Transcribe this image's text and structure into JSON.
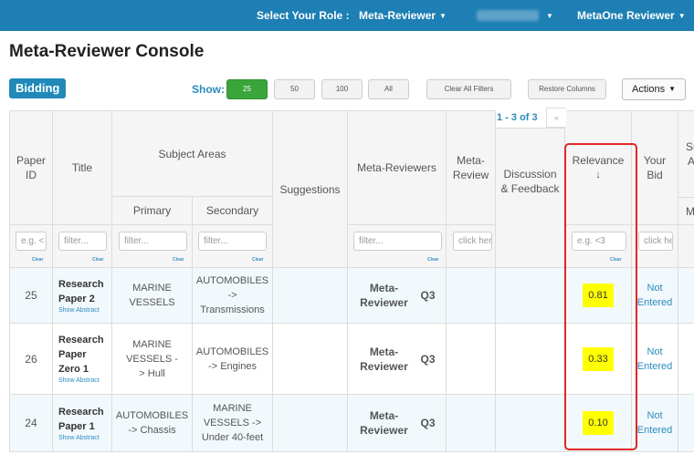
{
  "topbar": {
    "role_label": "Select Your Role :",
    "role_value": "Meta-Reviewer",
    "user_name": "MetaOne Reviewer"
  },
  "page_title": "Meta-Reviewer Console",
  "tab": "Bidding",
  "show_label": "Show:",
  "page_size_options": [
    "25",
    "50",
    "100",
    "All"
  ],
  "selected_page_size": "25",
  "clear_filters_label": "Clear All Filters",
  "restore_columns_label": "Restore Columns",
  "actions_label": "Actions",
  "pager": {
    "text": "1 - 3 of 3",
    "prev_label": "«"
  },
  "columns": {
    "paper_id": "Paper ID",
    "title": "Title",
    "subject_areas": "Subject Areas",
    "primary": "Primary",
    "secondary": "Secondary",
    "suggestions": "Suggestions",
    "meta_reviewers": "Meta-Reviewers",
    "meta_review": "Meta-Review",
    "discussion": "Discussion & Feedback",
    "relevance": "Relevance",
    "sort_indicator": "↓",
    "your_bid": "Your Bid",
    "cut_off": "Su A",
    "cut_off_sub": "Mi"
  },
  "filters": {
    "paper_id_placeholder": "e.g. <",
    "title_placeholder": "filter...",
    "primary_placeholder": "filter...",
    "secondary_placeholder": "filter...",
    "meta_reviewers_placeholder": "filter...",
    "meta_review_placeholder": "click here",
    "relevance_placeholder": "e.g. <3",
    "your_bid_placeholder": "click here",
    "clear_label": "Clear"
  },
  "rows": [
    {
      "id": "25",
      "title": "Research Paper 2",
      "show_abstract": "Show Abstract",
      "primary": "MARINE VESSELS",
      "secondary": "AUTOMOBILES -> Transmissions",
      "meta_reviewer": "Meta-Reviewer",
      "meta_reviewer_q": "Q3",
      "relevance": "0.81",
      "bid": "Not Entered"
    },
    {
      "id": "26",
      "title": "Research Paper Zero 1",
      "show_abstract": "Show Abstract",
      "primary": "MARINE VESSELS -> Hull",
      "secondary": "AUTOMOBILES -> Engines",
      "meta_reviewer": "Meta-Reviewer",
      "meta_reviewer_q": "Q3",
      "relevance": "0.33",
      "bid": "Not Entered"
    },
    {
      "id": "24",
      "title": "Research Paper 1",
      "show_abstract": "Show Abstract",
      "primary": "AUTOMOBILES -> Chassis",
      "secondary": "MARINE VESSELS -> Under 40-feet",
      "meta_reviewer": "Meta-Reviewer",
      "meta_reviewer_q": "Q3",
      "relevance": "0.10",
      "bid": "Not Entered"
    }
  ],
  "colors": {
    "topbar": "#1d7fb3",
    "accent": "#2089b8",
    "active_button": "#3aa53a",
    "relevance_highlight": "#ffff00",
    "annotation_box": "#e32626"
  }
}
